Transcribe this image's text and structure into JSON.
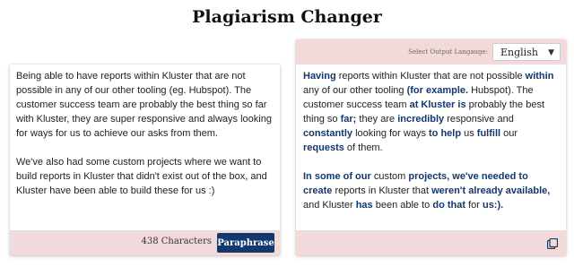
{
  "page": {
    "title": "Plagiarism Changer"
  },
  "input": {
    "text": "Being able to have reports within Kluster that are not possible in any of our other tooling (eg. Hubspot). The customer success team are probably the best thing so far with Kluster, they are super responsive and always looking for ways for us to achieve our asks from them.\n\nWe've also had some custom projects where we want to build reports in Kluster that didn't exist out of the box, and Kluster have been able to build these for us :)",
    "char_count_label": "438 Characters",
    "paraphrase_label": "Paraphrase"
  },
  "output": {
    "lang_label": "Select Output Langauge:",
    "lang_selected": "English",
    "paragraphs": [
      [
        {
          "t": "Having",
          "c": true
        },
        {
          "t": " reports within Kluster that are not possible ",
          "c": false
        },
        {
          "t": "within",
          "c": true
        },
        {
          "t": " any of our other tooling ",
          "c": false
        },
        {
          "t": "(for example.",
          "c": true
        },
        {
          "t": " Hubspot). The customer success team ",
          "c": false
        },
        {
          "t": "at Kluster is",
          "c": true
        },
        {
          "t": " probably the best thing so ",
          "c": false
        },
        {
          "t": "far;",
          "c": true
        },
        {
          "t": " they are ",
          "c": false
        },
        {
          "t": "incredibly",
          "c": true
        },
        {
          "t": " responsive and ",
          "c": false
        },
        {
          "t": "constantly",
          "c": true
        },
        {
          "t": " looking for ways ",
          "c": false
        },
        {
          "t": "to help",
          "c": true
        },
        {
          "t": " us ",
          "c": false
        },
        {
          "t": "fulfill",
          "c": true
        },
        {
          "t": " our ",
          "c": false
        },
        {
          "t": "requests",
          "c": true
        },
        {
          "t": " of them.",
          "c": false
        }
      ],
      [
        {
          "t": "In some of our",
          "c": true
        },
        {
          "t": " custom ",
          "c": false
        },
        {
          "t": "projects, we've needed to create",
          "c": true
        },
        {
          "t": " reports in Kluster that ",
          "c": false
        },
        {
          "t": "weren't already available,",
          "c": true
        },
        {
          "t": " and Kluster ",
          "c": false
        },
        {
          "t": "has",
          "c": true
        },
        {
          "t": " been able to ",
          "c": false
        },
        {
          "t": "do that",
          "c": true
        },
        {
          "t": " for ",
          "c": false
        },
        {
          "t": "us:).",
          "c": true
        }
      ]
    ]
  },
  "icons": {
    "copy": "copy-icon",
    "dropdown": "chevron-down-icon"
  },
  "colors": {
    "accent": "#13386b",
    "bar": "#f3dada"
  }
}
